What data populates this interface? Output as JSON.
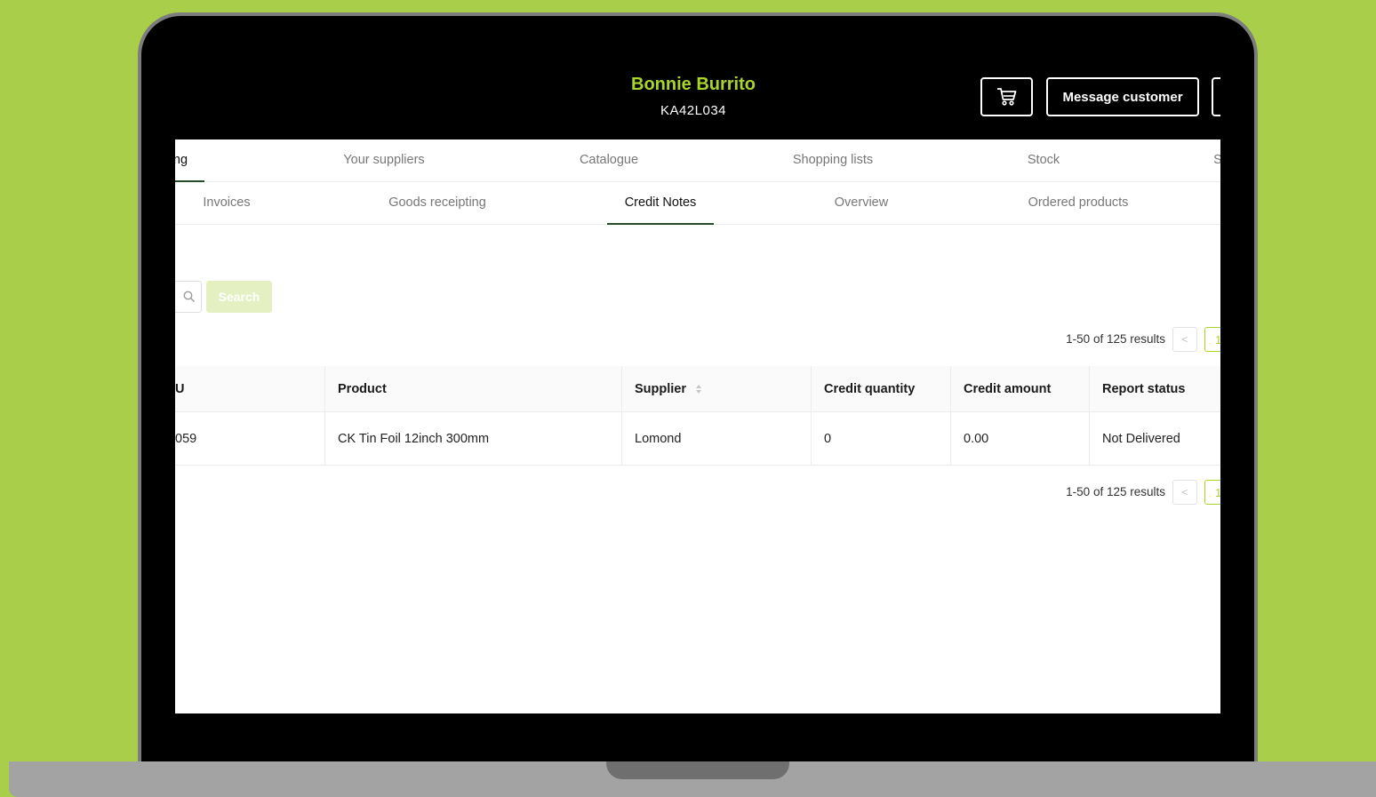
{
  "header": {
    "customer_name": "Bonnie Burrito",
    "customer_code": "KA42L034",
    "cart_icon": "cart-icon",
    "message_customer_label": "Message customer"
  },
  "primary_nav": [
    {
      "label": "ng",
      "active": true
    },
    {
      "label": "Your suppliers",
      "active": false
    },
    {
      "label": "Catalogue",
      "active": false
    },
    {
      "label": "Shopping lists",
      "active": false
    },
    {
      "label": "Stock",
      "active": false
    },
    {
      "label": "S",
      "active": false
    }
  ],
  "secondary_nav": [
    {
      "label": "Invoices",
      "active": false
    },
    {
      "label": "Goods receipting",
      "active": false
    },
    {
      "label": "Credit Notes",
      "active": true
    },
    {
      "label": "Overview",
      "active": false
    },
    {
      "label": "Ordered products",
      "active": false
    }
  ],
  "search": {
    "button_label": "Search",
    "icon": "search-icon"
  },
  "pagination": {
    "summary": "1-50 of 125 results",
    "prev_icon": "chevron-left-icon",
    "page": "1"
  },
  "table": {
    "columns": [
      "U",
      "Product",
      "Supplier",
      "Credit quantity",
      "Credit amount",
      "Report status"
    ],
    "rows": [
      [
        "059",
        "CK Tin Foil 12inch 300mm",
        "Lomond",
        "0",
        "0.00",
        "Not Delivered"
      ]
    ]
  },
  "colors": {
    "accent": "#a9d42c",
    "background": "#a9cf4a",
    "active_underline": "#244c2a"
  }
}
